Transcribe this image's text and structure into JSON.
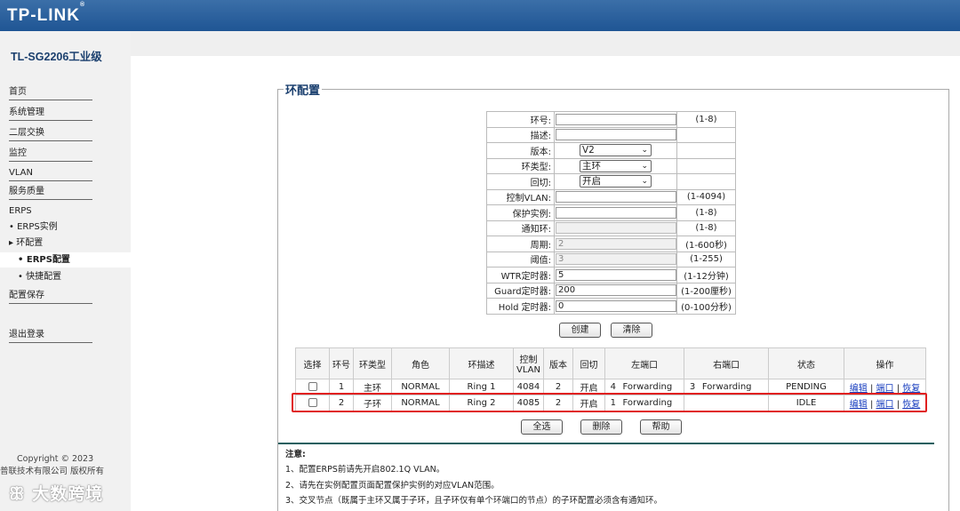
{
  "brand": {
    "logo": "TP-LINK",
    "model": "TL-SG2206工业级"
  },
  "nav": {
    "home": "首页",
    "system": "系统管理",
    "l2": "二层交换",
    "monitor": "监控",
    "vlan": "VLAN",
    "qos": "服务质量",
    "erps": "ERPS",
    "erps_instance": "ERPS实例",
    "ring_config": "环配置",
    "erps_config": "ERPS配置",
    "quick_config": "快捷配置",
    "save": "配置保存",
    "logout": "退出登录"
  },
  "footer": {
    "copyright": "Copyright © 2023",
    "company": "普联技术有限公司 版权所有",
    "watermark": "大数跨境"
  },
  "page_title": "环配置",
  "form": {
    "ring_id": {
      "label": "环号:",
      "value": "",
      "range": "(1-8)"
    },
    "desc": {
      "label": "描述:",
      "value": ""
    },
    "version": {
      "label": "版本:",
      "value": "V2"
    },
    "ring_type": {
      "label": "环类型:",
      "value": "主环"
    },
    "revertive": {
      "label": "回切:",
      "value": "开启"
    },
    "ctrl_vlan": {
      "label": "控制VLAN:",
      "value": "",
      "range": "(1-4094)"
    },
    "protect_inst": {
      "label": "保护实例:",
      "value": "",
      "range": "(1-8)"
    },
    "notify_ring": {
      "label": "通知环:",
      "value": "",
      "range": "(1-8)"
    },
    "period": {
      "label": "周期:",
      "value": "2",
      "range": "(1-600秒)"
    },
    "threshold": {
      "label": "阈值:",
      "value": "3",
      "range": "(1-255)"
    },
    "wtr": {
      "label": "WTR定时器:",
      "value": "5",
      "range": "(1-12分钟)"
    },
    "guard": {
      "label": "Guard定时器:",
      "value": "200",
      "range": "(1-200厘秒)"
    },
    "hold": {
      "label": "Hold 定时器:",
      "value": "0",
      "range": "(0-100分秒)"
    }
  },
  "buttons": {
    "create": "创建",
    "clear": "清除",
    "select_all": "全选",
    "delete": "删除",
    "help": "帮助"
  },
  "table": {
    "headers": {
      "select": "选择",
      "ring": "环号",
      "type": "环类型",
      "role": "角色",
      "desc": "环描述",
      "ctrl_vlan_1": "控制",
      "ctrl_vlan_2": "VLAN",
      "version": "版本",
      "revert": "回切",
      "left": "左端口",
      "right": "右端口",
      "state": "状态",
      "ops": "操作"
    },
    "rows": [
      {
        "ring": "1",
        "type": "主环",
        "role": "NORMAL",
        "desc": "Ring 1",
        "vlan": "4084",
        "version": "2",
        "revert": "开启",
        "left_port": "4",
        "left_state": "Forwarding",
        "right_port": "3",
        "right_state": "Forwarding",
        "state": "PENDING",
        "edit": "编辑",
        "port": "端口",
        "restore": "恢复"
      },
      {
        "ring": "2",
        "type": "子环",
        "role": "NORMAL",
        "desc": "Ring 2",
        "vlan": "4085",
        "version": "2",
        "revert": "开启",
        "left_port": "1",
        "left_state": "Forwarding",
        "right_port": "",
        "right_state": "",
        "state": "IDLE",
        "edit": "编辑",
        "port": "端口",
        "restore": "恢复"
      }
    ],
    "sep": "|"
  },
  "notes": {
    "title": "注意:",
    "n1": "1、配置ERPS前请先开启802.1Q VLAN。",
    "n2": "2、请先在实例配置页面配置保护实例的对应VLAN范围。",
    "n3": "3、交叉节点（既属于主环又属于子环，且子环仅有单个环端口的节点）的子环配置必须含有通知环。"
  },
  "colors": {
    "header": "#2a62a0",
    "link": "#1a3fbf",
    "highlight": "#e02020"
  }
}
